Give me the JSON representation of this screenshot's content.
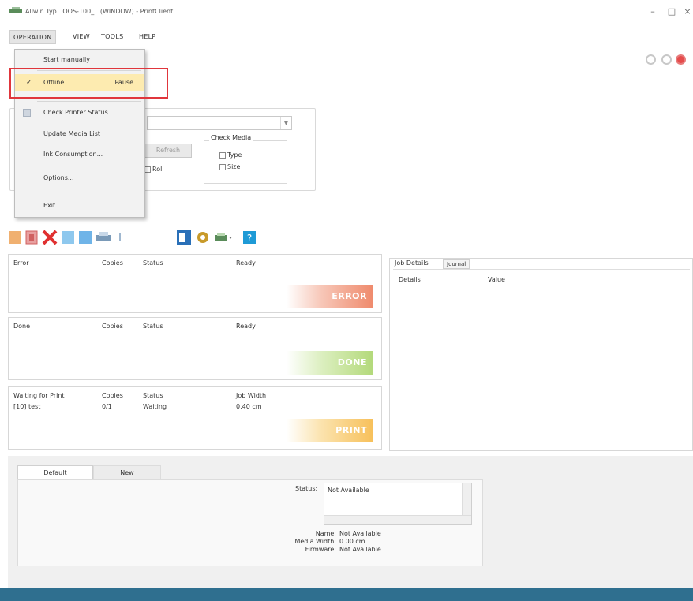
{
  "window": {
    "title": "Allwin Typ...OOS-100_...(WINDOW) - PrintClient",
    "minimize": "–",
    "maximize": "□",
    "close": "×"
  },
  "menubar": {
    "items": [
      "OPERATION",
      "VIEW",
      "TOOLS",
      "HELP"
    ]
  },
  "operation_menu": {
    "start_manually": "Start manually",
    "offline": "Offline",
    "offline_checked": "✓",
    "offline_shortcut": "Pause",
    "check_printer_status": "Check Printer Status",
    "update_media_list": "Update Media List",
    "ink_consumption": "Ink Consumption...",
    "options": "Options...",
    "exit": "Exit"
  },
  "settings": {
    "refresh_label": "Refresh",
    "roll_label": "Roll",
    "check_media_title": "Check Media",
    "type_label": "Type",
    "size_label": "Size",
    "dropdown_arrow": "▼"
  },
  "queues": {
    "error": {
      "headers": [
        "Error",
        "Copies",
        "Status",
        "Ready"
      ],
      "badge": "ERROR"
    },
    "done": {
      "headers": [
        "Done",
        "Copies",
        "Status",
        "Ready"
      ],
      "badge": "DONE"
    },
    "waiting": {
      "headers": [
        "Waiting for Print",
        "Copies",
        "Status",
        "Job Width"
      ],
      "row": [
        "[10] test",
        "0/1",
        "Waiting",
        "0.40 cm"
      ],
      "badge": "PRINT"
    }
  },
  "job_details": {
    "tab_details": "Job Details",
    "tab_journal": "Journal",
    "col_details": "Details",
    "col_value": "Value"
  },
  "printer_info": {
    "tab_default": "Default",
    "tab_new": "New",
    "status_label": "Status:",
    "status_value": "Not Available",
    "name_label": "Name:",
    "name_value": "Not Available",
    "media_width_label": "Media Width:",
    "media_width_value": "0.00 cm",
    "firmware_label": "Firmware:",
    "firmware_value": "Not Available"
  },
  "colors": {
    "highlight_border": "#e0363c",
    "offline_bg": "#fdebb0",
    "error_badge": "#ef8a6c",
    "done_badge": "#b3d97a",
    "print_badge": "#f7c05a",
    "status_strip": "#2f6f8f"
  }
}
